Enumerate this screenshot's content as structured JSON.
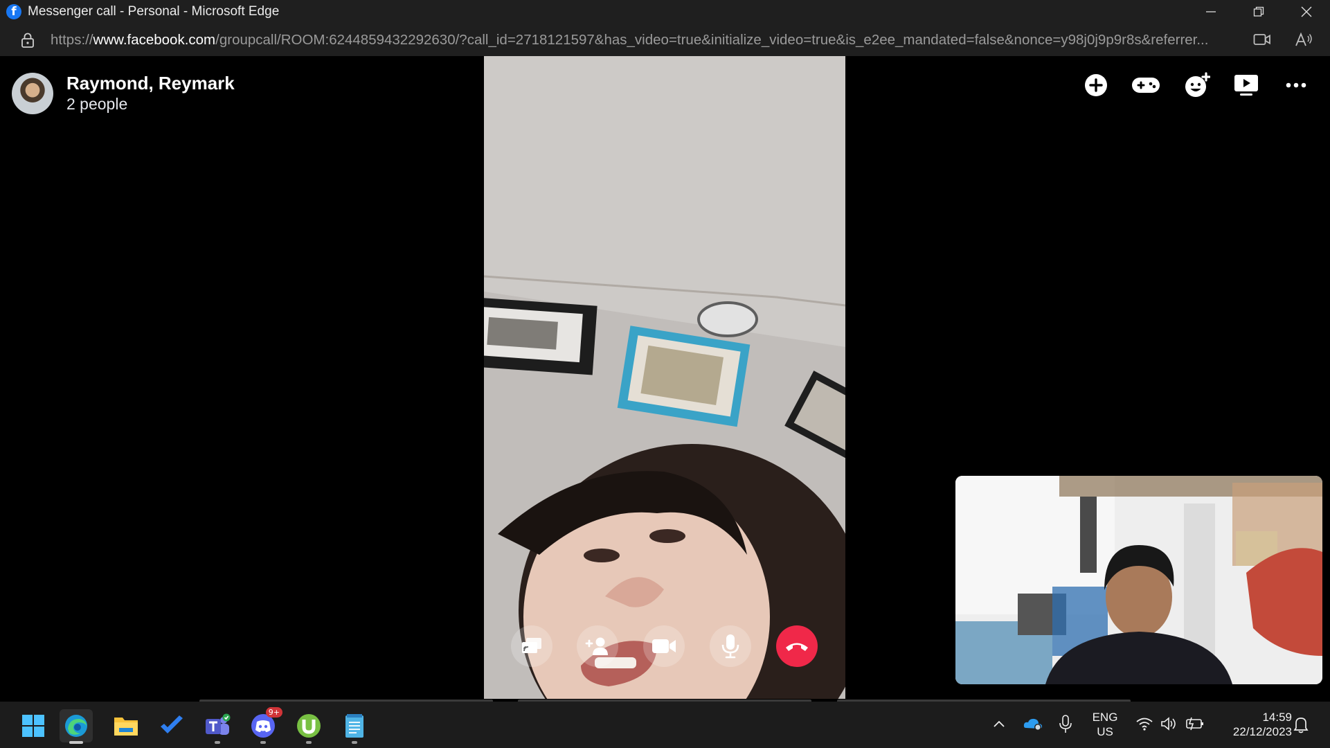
{
  "window": {
    "title": "Messenger call - Personal - Microsoft Edge",
    "app_icon": "facebook-icon"
  },
  "addressbar": {
    "url_prefix": "https://",
    "url_host": "www.facebook.com",
    "url_path": "/groupcall/ROOM:6244859432292630/?call_id=2718121597&has_video=true&initialize_video=true&is_e2ee_mandated=false&nonce=y98j0j9p9r8s&referrer..."
  },
  "call": {
    "name": "Raymond, Reymark",
    "participants": "2 people"
  },
  "top_actions": [
    "add-icon",
    "game-controller-icon",
    "add-effect-icon",
    "share-screen-icon",
    "more-icon"
  ],
  "controls": [
    "share-screen-icon",
    "add-person-icon",
    "camera-icon",
    "microphone-icon",
    "end-call-icon"
  ],
  "taskbar": {
    "apps": [
      "windows-start-icon",
      "edge-icon",
      "file-explorer-icon",
      "todo-icon",
      "teams-icon",
      "discord-icon",
      "utorrent-icon",
      "notepad-icon"
    ],
    "discord_badge": "9+",
    "language": "ENG",
    "region": "US",
    "time": "14:59",
    "date": "22/12/2023"
  },
  "colors": {
    "facebook_blue": "#1877f2",
    "end_call_red": "#f02849",
    "background": "#000000"
  }
}
